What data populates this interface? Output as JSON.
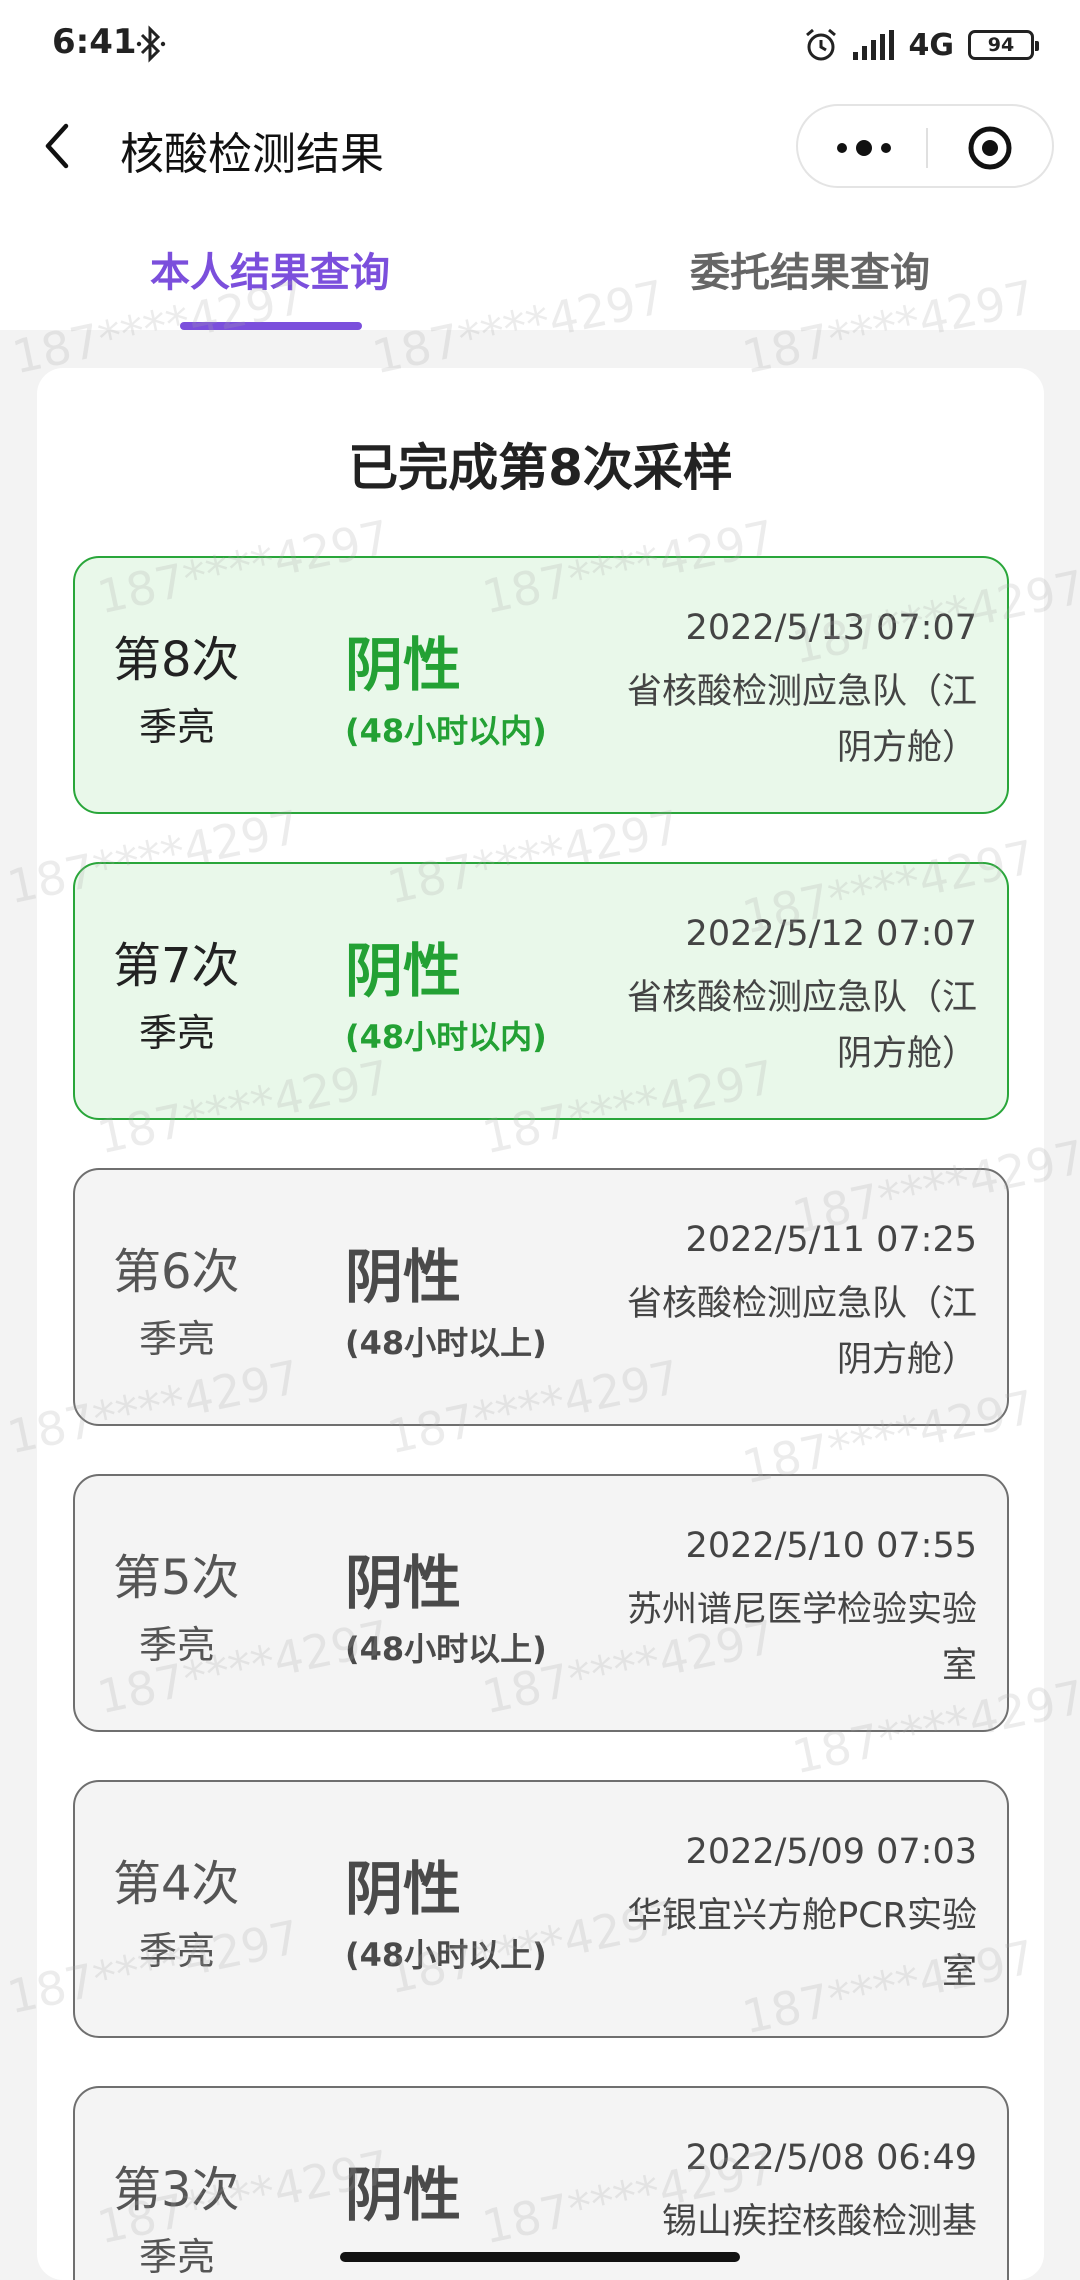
{
  "status_bar": {
    "time": "6:41",
    "network": "4G",
    "battery": "94"
  },
  "nav": {
    "title": "核酸检测结果"
  },
  "tabs": [
    {
      "label": "本人结果查询",
      "active": true
    },
    {
      "label": "委托结果查询",
      "active": false
    }
  ],
  "summary": {
    "title": "已完成第8次采样"
  },
  "records": [
    {
      "count": "第8次",
      "name": "季亮",
      "result": "阴性",
      "window": "(48小时以内)",
      "time": "2022/5/13 07:07",
      "org": "省核酸检测应急队（江阴方舱）"
    },
    {
      "count": "第7次",
      "name": "季亮",
      "result": "阴性",
      "window": "(48小时以内)",
      "time": "2022/5/12 07:07",
      "org": "省核酸检测应急队（江阴方舱）"
    },
    {
      "count": "第6次",
      "name": "季亮",
      "result": "阴性",
      "window": "(48小时以上)",
      "time": "2022/5/11 07:25",
      "org": "省核酸检测应急队（江阴方舱）"
    },
    {
      "count": "第5次",
      "name": "季亮",
      "result": "阴性",
      "window": "(48小时以上)",
      "time": "2022/5/10 07:55",
      "org": "苏州谱尼医学检验实验室"
    },
    {
      "count": "第4次",
      "name": "季亮",
      "result": "阴性",
      "window": "(48小时以上)",
      "time": "2022/5/09 07:03",
      "org": "华银宜兴方舱PCR实验室"
    },
    {
      "count": "第3次",
      "name": "季亮",
      "result": "阴性",
      "window": "",
      "time": "2022/5/08 06:49",
      "org": "锡山疾控核酸检测基"
    }
  ],
  "watermark": "187****4297",
  "colors": {
    "accent": "#7b4fdc",
    "recent_green": "#23a134",
    "recent_bg": "#e9f8ea",
    "old_text": "#4a4a4a"
  },
  "icons": {
    "back": "back-icon",
    "more": "more-icon",
    "close_mini": "close-mini-icon",
    "bluetooth": "bluetooth-icon",
    "alarm": "alarm-icon",
    "signal": "signal-icon"
  }
}
